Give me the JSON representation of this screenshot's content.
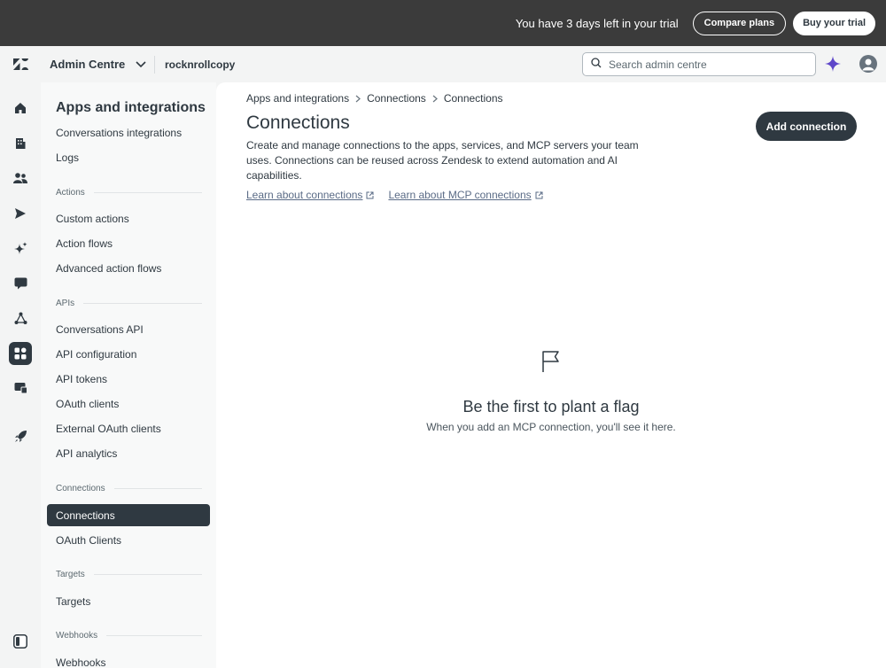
{
  "trial": {
    "message": "You have 3 days left in your trial",
    "compare_label": "Compare plans",
    "buy_label": "Buy your trial"
  },
  "header": {
    "product": "Admin Centre",
    "account": "rocknrollcopy",
    "search_placeholder": "Search admin centre"
  },
  "rail": {
    "icons": [
      "home-icon",
      "building-icon",
      "people-icon",
      "send-icon",
      "sparkle-icon",
      "chat-icon",
      "objects-icon",
      "apps-icon",
      "workspace-icon",
      "rocket-icon",
      "panel-toggle-icon"
    ]
  },
  "sidebar": {
    "title": "Apps and integrations",
    "items": [
      {
        "label": "Conversations integrations"
      },
      {
        "label": "Logs"
      }
    ],
    "sections": [
      {
        "heading": "Actions",
        "items": [
          "Custom actions",
          "Action flows",
          "Advanced action flows"
        ]
      },
      {
        "heading": "APIs",
        "items": [
          "Conversations API",
          "API configuration",
          "API tokens",
          "OAuth clients",
          "External OAuth clients",
          "API analytics"
        ]
      },
      {
        "heading": "Connections",
        "items": [
          "Connections",
          "OAuth Clients"
        ]
      },
      {
        "heading": "Targets",
        "items": [
          "Targets"
        ]
      },
      {
        "heading": "Webhooks",
        "items": [
          "Webhooks"
        ]
      }
    ],
    "active_item": "Connections"
  },
  "breadcrumb": [
    "Apps and integrations",
    "Connections",
    "Connections"
  ],
  "page": {
    "title": "Connections",
    "description": "Create and manage connections to the apps, services, and MCP servers your team uses. Connections can be reused across Zendesk to extend automation and AI capabilities.",
    "link_connections": "Learn about connections",
    "link_mcp": "Learn about MCP connections",
    "add_button": "Add connection"
  },
  "empty_state": {
    "title": "Be the first to plant a flag",
    "subtitle": "When you add an MCP connection, you'll see it here."
  },
  "colors": {
    "trial_bar": "#3b3b3b",
    "primary_dark": "#2f3941",
    "link": "#5a6b86",
    "sparkle": "#5e47c9"
  }
}
